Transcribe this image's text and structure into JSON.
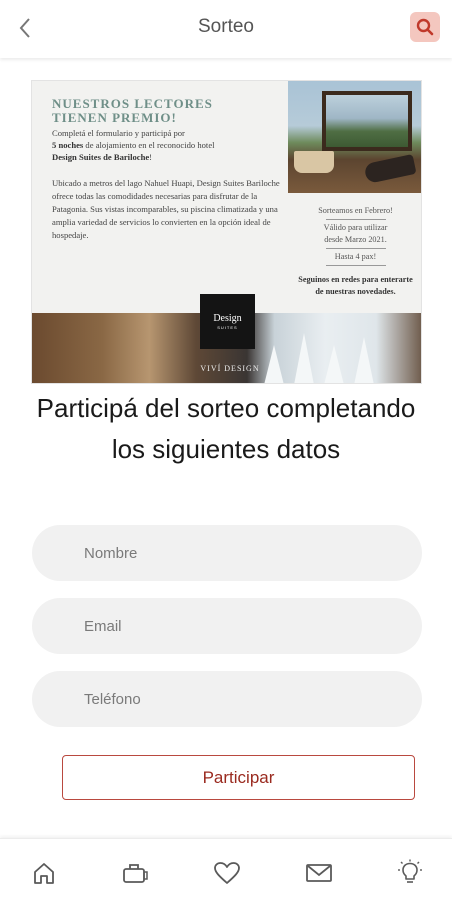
{
  "header": {
    "back_icon": "chevron-left-icon",
    "title": "Sorteo",
    "search_icon": "search-icon",
    "accent_color": "#c0392b"
  },
  "banner": {
    "headline_line1": "NUESTROS LECTORES",
    "headline_line2": "TIENEN PREMIO!",
    "intro_part1": "Completá el formulario y participá por",
    "intro_bold1": "5 noches",
    "intro_part2": " de alojamiento en el reconocido hotel",
    "intro_bold2": "Design Suites de Bariloche",
    "intro_end": "!",
    "description": "Ubicado a metros del lago Nahuel Huapi, Design Suites Bariloche ofrece todas las comodidades necesarias para disfrutar de la Patagonia. Sus vistas incomparables, su piscina climatizada y una amplia variedad de servicios lo convierten en la opción ideal de hospedaje.",
    "draw_note": "Sorteamos en Febrero!",
    "valid_line1": "Válido para utilizar",
    "valid_line2": "desde Marzo 2021.",
    "valid_line3": "Hasta 4 pax!",
    "follow_line1": "Seguinos en redes para enterarte",
    "follow_line2": "de nuestras novedades.",
    "logo_text": "Design",
    "logo_sub": "SUITES",
    "live_text": "VIVÍ DESIGN"
  },
  "form": {
    "heading": "Participá del sorteo completando los siguientes datos",
    "name_placeholder": "Nombre",
    "email_placeholder": "Email",
    "phone_placeholder": "Teléfono",
    "submit_label": "Participar"
  },
  "tabbar": {
    "items": [
      "home-icon",
      "suitcase-icon",
      "heart-icon",
      "mail-icon",
      "lightbulb-icon"
    ]
  }
}
